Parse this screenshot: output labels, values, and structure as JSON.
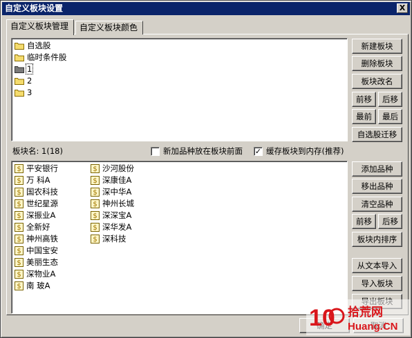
{
  "window": {
    "title": "自定义板块设置",
    "close": "X"
  },
  "tabs": [
    {
      "label": "自定义板块管理",
      "active": true
    },
    {
      "label": "自定义板块颜色",
      "active": false
    }
  ],
  "tree": [
    {
      "label": "自选股",
      "icon": "folder-icon"
    },
    {
      "label": "临时条件股",
      "icon": "folder-icon"
    },
    {
      "label": "1",
      "icon": "folder-icon",
      "selected": true
    },
    {
      "label": "2",
      "icon": "folder-icon"
    },
    {
      "label": "3",
      "icon": "folder-icon"
    }
  ],
  "tree_buttons": {
    "new": "新建板块",
    "delete": "删除板块",
    "rename": "板块改名",
    "move_up": "前移",
    "move_down": "后移",
    "move_first": "最前",
    "move_last": "最后",
    "migrate": "自选股迁移"
  },
  "block_name": {
    "label": "板块名:",
    "value": "1(18)"
  },
  "options": {
    "new_front": {
      "label": "新加品种放在板块前面",
      "checked": false
    },
    "cache_memory": {
      "label": "缓存板块到内存(推荐)",
      "checked": true
    }
  },
  "stocks_col1": [
    "平安银行",
    "万 科A",
    "国农科技",
    "世纪星源",
    "深振业A",
    "全新好",
    "神州高铁",
    "中国宝安",
    "美丽生态",
    "深物业A",
    "南 玻A"
  ],
  "stocks_col2": [
    "沙河股份",
    "深康佳A",
    "深中华A",
    "神州长城",
    "深深宝A",
    "深华发A",
    "深科技"
  ],
  "stock_buttons": {
    "add": "添加品种",
    "remove": "移出品种",
    "clear": "清空品种",
    "move_up": "前移",
    "move_down": "后移",
    "sort": "板块内排序",
    "import_text": "从文本导入",
    "import_block": "导入板块",
    "export_block": "导出板块"
  },
  "footer_buttons": {
    "ok": "确定",
    "cancel": "取消"
  },
  "watermark": {
    "digits": "10",
    "brand": "拾荒网",
    "site": "Huang.CN"
  },
  "colors": {
    "titlebar": "#0a246a",
    "face": "#d4d0c8",
    "watermark_red": "#d9161b"
  }
}
